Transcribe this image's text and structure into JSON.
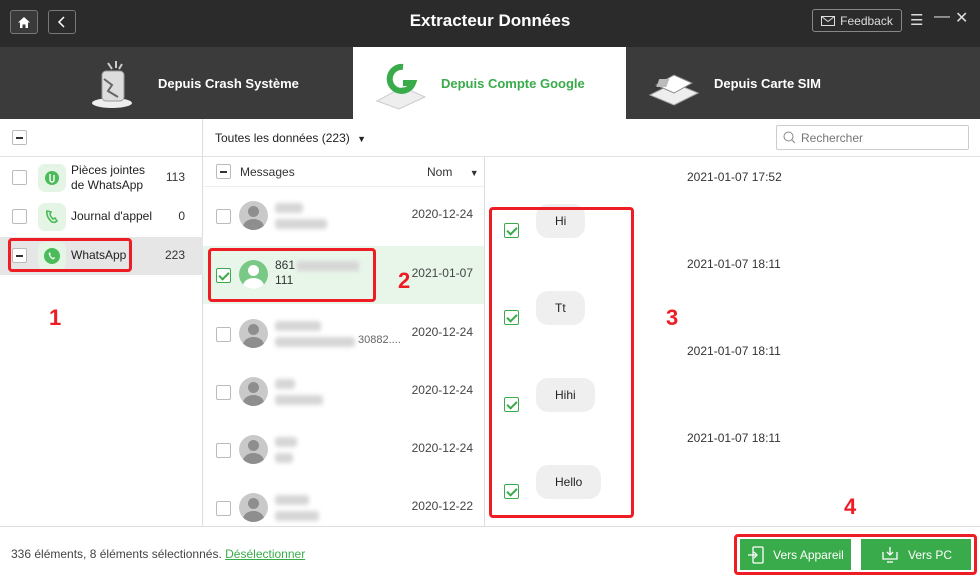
{
  "app": {
    "title": "Extracteur Données",
    "feedback": "Feedback"
  },
  "tabs": [
    {
      "label": "Depuis Crash Système"
    },
    {
      "label": "Depuis Compte Google"
    },
    {
      "label": "Depuis Carte SIM"
    }
  ],
  "sidebar": {
    "items": [
      {
        "label": "Pièces jointes de WhatsApp",
        "count": "113"
      },
      {
        "label": "Journal d'appel",
        "count": "0"
      },
      {
        "label": "WhatsApp",
        "count": "223"
      }
    ]
  },
  "filter": {
    "label": "Toutes les données (223)",
    "search_placeholder": "Rechercher"
  },
  "list": {
    "header_label": "Messages",
    "sort_label": "Nom",
    "conversations": [
      {
        "date": "2020-12-24"
      },
      {
        "name_prefix": "861",
        "name_suffix": "111",
        "date": "2021-01-07"
      },
      {
        "partial_text": "30882....",
        "date": "2020-12-24"
      },
      {
        "date": "2020-12-24"
      },
      {
        "date": "2020-12-24"
      },
      {
        "date": "2020-12-22"
      }
    ]
  },
  "chat": {
    "messages": [
      {
        "time": "2021-01-07 17:52",
        "text": "Hi"
      },
      {
        "time": "2021-01-07 18:11",
        "text": "Tt"
      },
      {
        "time": "2021-01-07 18:11",
        "text": "Hihi"
      },
      {
        "time": "2021-01-07 18:11",
        "text": "Hello"
      }
    ]
  },
  "annotations": [
    "1",
    "2",
    "3",
    "4"
  ],
  "footer": {
    "status": "336 éléments, 8 éléments sélectionnés.",
    "deselect": "Désélectionner",
    "to_device": "Vers Appareil",
    "to_pc": "Vers PC"
  },
  "colors": {
    "accent": "#3aab4a",
    "annotation": "#ee1c25",
    "titlebar": "#2b2b2b",
    "tabsbar": "#3b3b3b"
  }
}
